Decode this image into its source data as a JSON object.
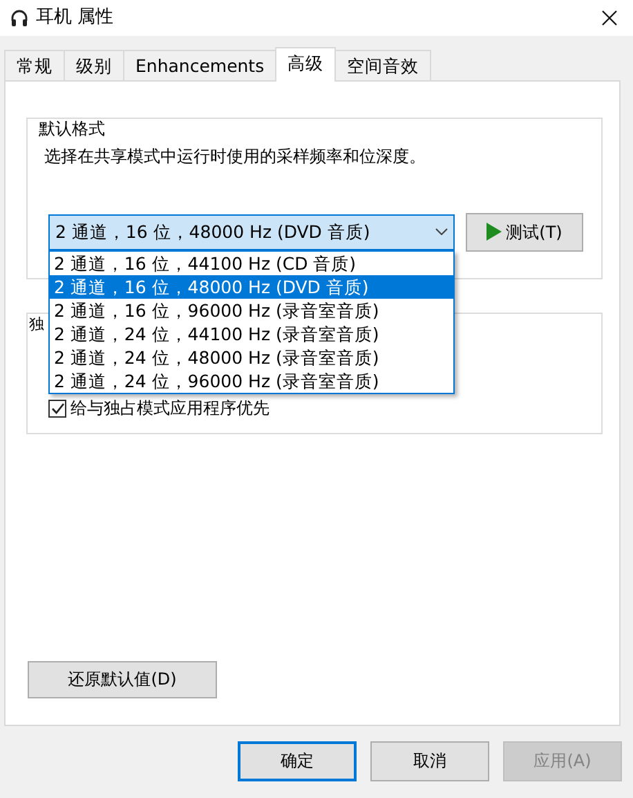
{
  "window": {
    "title": "耳机 属性"
  },
  "tabs": [
    {
      "label": "常规",
      "selected": false
    },
    {
      "label": "级别",
      "selected": false
    },
    {
      "label": "Enhancements",
      "selected": false
    },
    {
      "label": "高级",
      "selected": true
    },
    {
      "label": "空间音效",
      "selected": false
    }
  ],
  "default_format": {
    "title": "默认格式",
    "description": "选择在共享模式中运行时使用的采样频率和位深度。",
    "format_select": {
      "value": "2 通道，16 位，48000 Hz (DVD 音质)",
      "expanded": true
    },
    "test_button": "测试(T)",
    "options": [
      {
        "label": "2 通道，16 位，44100 Hz (CD 音质)",
        "selected": false
      },
      {
        "label": "2 通道，16 位，48000 Hz (DVD 音质)",
        "selected": true
      },
      {
        "label": "2 通道，16 位，96000 Hz (录音室音质)",
        "selected": false
      },
      {
        "label": "2 通道，24 位，44100 Hz (录音室音质)",
        "selected": false
      },
      {
        "label": "2 通道，24 位，48000 Hz (录音室音质)",
        "selected": false
      },
      {
        "label": "2 通道，24 位，96000 Hz (录音室音质)",
        "selected": false
      }
    ]
  },
  "exclusive_mode": {
    "title": "独",
    "checkbox": {
      "label": "给与独占模式应用程序优先",
      "checked": true
    }
  },
  "restore_button": "还原默认值(D)",
  "buttons": [
    {
      "label": "确定",
      "kind": "default"
    },
    {
      "label": "取消",
      "kind": "normal"
    },
    {
      "label": "应用(A)",
      "kind": "disabled"
    }
  ]
}
